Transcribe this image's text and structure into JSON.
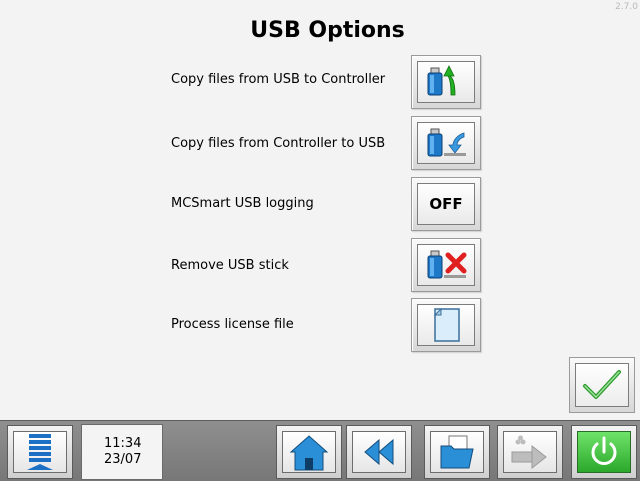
{
  "version": "2.7.0",
  "title": "USB Options",
  "options": [
    {
      "label": "Copy files from USB to Controller",
      "icon": "usb-to-controller-icon"
    },
    {
      "label": "Copy files from Controller to USB",
      "icon": "controller-to-usb-icon"
    },
    {
      "label": "MCSmart USB logging",
      "button_text": "OFF"
    },
    {
      "label": "Remove USB stick",
      "icon": "remove-usb-icon"
    },
    {
      "label": "Process license file",
      "icon": "document-icon"
    }
  ],
  "confirm": {
    "icon": "checkmark-icon"
  },
  "bottom_bar": {
    "menu_icon": "menu-list-icon",
    "clock": {
      "time": "11:34",
      "date": "23/07"
    },
    "buttons": [
      {
        "icon": "home-icon"
      },
      {
        "icon": "rewind-icon"
      },
      {
        "icon": "folder-icon"
      },
      {
        "icon": "forward-disabled-icon",
        "enabled": false
      },
      {
        "icon": "power-icon"
      }
    ]
  },
  "colors": {
    "accent_green": "#3cc43c",
    "usb_blue": "#1e78c8",
    "arrow_green": "#22b022",
    "remove_red": "#e02020"
  }
}
